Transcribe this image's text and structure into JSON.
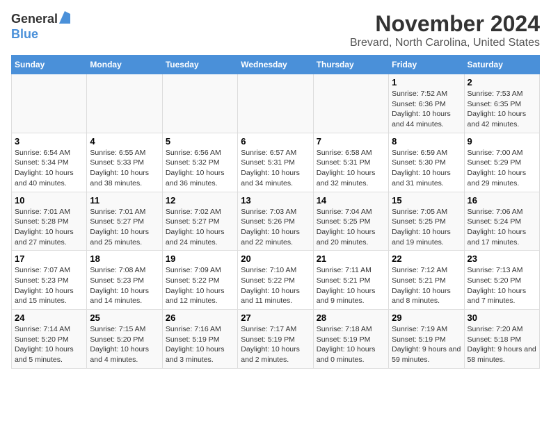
{
  "header": {
    "logo_general": "General",
    "logo_blue": "Blue",
    "month_title": "November 2024",
    "location": "Brevard, North Carolina, United States"
  },
  "calendar": {
    "weekdays": [
      "Sunday",
      "Monday",
      "Tuesday",
      "Wednesday",
      "Thursday",
      "Friday",
      "Saturday"
    ],
    "weeks": [
      [
        {
          "day": "",
          "info": ""
        },
        {
          "day": "",
          "info": ""
        },
        {
          "day": "",
          "info": ""
        },
        {
          "day": "",
          "info": ""
        },
        {
          "day": "",
          "info": ""
        },
        {
          "day": "1",
          "info": "Sunrise: 7:52 AM\nSunset: 6:36 PM\nDaylight: 10 hours and 44 minutes."
        },
        {
          "day": "2",
          "info": "Sunrise: 7:53 AM\nSunset: 6:35 PM\nDaylight: 10 hours and 42 minutes."
        }
      ],
      [
        {
          "day": "3",
          "info": "Sunrise: 6:54 AM\nSunset: 5:34 PM\nDaylight: 10 hours and 40 minutes."
        },
        {
          "day": "4",
          "info": "Sunrise: 6:55 AM\nSunset: 5:33 PM\nDaylight: 10 hours and 38 minutes."
        },
        {
          "day": "5",
          "info": "Sunrise: 6:56 AM\nSunset: 5:32 PM\nDaylight: 10 hours and 36 minutes."
        },
        {
          "day": "6",
          "info": "Sunrise: 6:57 AM\nSunset: 5:31 PM\nDaylight: 10 hours and 34 minutes."
        },
        {
          "day": "7",
          "info": "Sunrise: 6:58 AM\nSunset: 5:31 PM\nDaylight: 10 hours and 32 minutes."
        },
        {
          "day": "8",
          "info": "Sunrise: 6:59 AM\nSunset: 5:30 PM\nDaylight: 10 hours and 31 minutes."
        },
        {
          "day": "9",
          "info": "Sunrise: 7:00 AM\nSunset: 5:29 PM\nDaylight: 10 hours and 29 minutes."
        }
      ],
      [
        {
          "day": "10",
          "info": "Sunrise: 7:01 AM\nSunset: 5:28 PM\nDaylight: 10 hours and 27 minutes."
        },
        {
          "day": "11",
          "info": "Sunrise: 7:01 AM\nSunset: 5:27 PM\nDaylight: 10 hours and 25 minutes."
        },
        {
          "day": "12",
          "info": "Sunrise: 7:02 AM\nSunset: 5:27 PM\nDaylight: 10 hours and 24 minutes."
        },
        {
          "day": "13",
          "info": "Sunrise: 7:03 AM\nSunset: 5:26 PM\nDaylight: 10 hours and 22 minutes."
        },
        {
          "day": "14",
          "info": "Sunrise: 7:04 AM\nSunset: 5:25 PM\nDaylight: 10 hours and 20 minutes."
        },
        {
          "day": "15",
          "info": "Sunrise: 7:05 AM\nSunset: 5:25 PM\nDaylight: 10 hours and 19 minutes."
        },
        {
          "day": "16",
          "info": "Sunrise: 7:06 AM\nSunset: 5:24 PM\nDaylight: 10 hours and 17 minutes."
        }
      ],
      [
        {
          "day": "17",
          "info": "Sunrise: 7:07 AM\nSunset: 5:23 PM\nDaylight: 10 hours and 15 minutes."
        },
        {
          "day": "18",
          "info": "Sunrise: 7:08 AM\nSunset: 5:23 PM\nDaylight: 10 hours and 14 minutes."
        },
        {
          "day": "19",
          "info": "Sunrise: 7:09 AM\nSunset: 5:22 PM\nDaylight: 10 hours and 12 minutes."
        },
        {
          "day": "20",
          "info": "Sunrise: 7:10 AM\nSunset: 5:22 PM\nDaylight: 10 hours and 11 minutes."
        },
        {
          "day": "21",
          "info": "Sunrise: 7:11 AM\nSunset: 5:21 PM\nDaylight: 10 hours and 9 minutes."
        },
        {
          "day": "22",
          "info": "Sunrise: 7:12 AM\nSunset: 5:21 PM\nDaylight: 10 hours and 8 minutes."
        },
        {
          "day": "23",
          "info": "Sunrise: 7:13 AM\nSunset: 5:20 PM\nDaylight: 10 hours and 7 minutes."
        }
      ],
      [
        {
          "day": "24",
          "info": "Sunrise: 7:14 AM\nSunset: 5:20 PM\nDaylight: 10 hours and 5 minutes."
        },
        {
          "day": "25",
          "info": "Sunrise: 7:15 AM\nSunset: 5:20 PM\nDaylight: 10 hours and 4 minutes."
        },
        {
          "day": "26",
          "info": "Sunrise: 7:16 AM\nSunset: 5:19 PM\nDaylight: 10 hours and 3 minutes."
        },
        {
          "day": "27",
          "info": "Sunrise: 7:17 AM\nSunset: 5:19 PM\nDaylight: 10 hours and 2 minutes."
        },
        {
          "day": "28",
          "info": "Sunrise: 7:18 AM\nSunset: 5:19 PM\nDaylight: 10 hours and 0 minutes."
        },
        {
          "day": "29",
          "info": "Sunrise: 7:19 AM\nSunset: 5:19 PM\nDaylight: 9 hours and 59 minutes."
        },
        {
          "day": "30",
          "info": "Sunrise: 7:20 AM\nSunset: 5:18 PM\nDaylight: 9 hours and 58 minutes."
        }
      ]
    ]
  }
}
